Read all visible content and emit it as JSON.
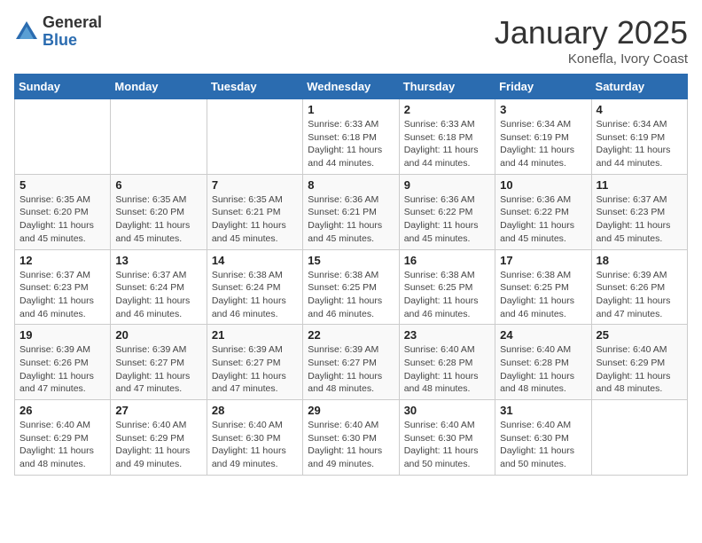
{
  "logo": {
    "general": "General",
    "blue": "Blue"
  },
  "title": "January 2025",
  "subtitle": "Konefla, Ivory Coast",
  "weekdays": [
    "Sunday",
    "Monday",
    "Tuesday",
    "Wednesday",
    "Thursday",
    "Friday",
    "Saturday"
  ],
  "weeks": [
    [
      {
        "day": "",
        "info": ""
      },
      {
        "day": "",
        "info": ""
      },
      {
        "day": "",
        "info": ""
      },
      {
        "day": "1",
        "info": "Sunrise: 6:33 AM\nSunset: 6:18 PM\nDaylight: 11 hours and 44 minutes."
      },
      {
        "day": "2",
        "info": "Sunrise: 6:33 AM\nSunset: 6:18 PM\nDaylight: 11 hours and 44 minutes."
      },
      {
        "day": "3",
        "info": "Sunrise: 6:34 AM\nSunset: 6:19 PM\nDaylight: 11 hours and 44 minutes."
      },
      {
        "day": "4",
        "info": "Sunrise: 6:34 AM\nSunset: 6:19 PM\nDaylight: 11 hours and 44 minutes."
      }
    ],
    [
      {
        "day": "5",
        "info": "Sunrise: 6:35 AM\nSunset: 6:20 PM\nDaylight: 11 hours and 45 minutes."
      },
      {
        "day": "6",
        "info": "Sunrise: 6:35 AM\nSunset: 6:20 PM\nDaylight: 11 hours and 45 minutes."
      },
      {
        "day": "7",
        "info": "Sunrise: 6:35 AM\nSunset: 6:21 PM\nDaylight: 11 hours and 45 minutes."
      },
      {
        "day": "8",
        "info": "Sunrise: 6:36 AM\nSunset: 6:21 PM\nDaylight: 11 hours and 45 minutes."
      },
      {
        "day": "9",
        "info": "Sunrise: 6:36 AM\nSunset: 6:22 PM\nDaylight: 11 hours and 45 minutes."
      },
      {
        "day": "10",
        "info": "Sunrise: 6:36 AM\nSunset: 6:22 PM\nDaylight: 11 hours and 45 minutes."
      },
      {
        "day": "11",
        "info": "Sunrise: 6:37 AM\nSunset: 6:23 PM\nDaylight: 11 hours and 45 minutes."
      }
    ],
    [
      {
        "day": "12",
        "info": "Sunrise: 6:37 AM\nSunset: 6:23 PM\nDaylight: 11 hours and 46 minutes."
      },
      {
        "day": "13",
        "info": "Sunrise: 6:37 AM\nSunset: 6:24 PM\nDaylight: 11 hours and 46 minutes."
      },
      {
        "day": "14",
        "info": "Sunrise: 6:38 AM\nSunset: 6:24 PM\nDaylight: 11 hours and 46 minutes."
      },
      {
        "day": "15",
        "info": "Sunrise: 6:38 AM\nSunset: 6:25 PM\nDaylight: 11 hours and 46 minutes."
      },
      {
        "day": "16",
        "info": "Sunrise: 6:38 AM\nSunset: 6:25 PM\nDaylight: 11 hours and 46 minutes."
      },
      {
        "day": "17",
        "info": "Sunrise: 6:38 AM\nSunset: 6:25 PM\nDaylight: 11 hours and 46 minutes."
      },
      {
        "day": "18",
        "info": "Sunrise: 6:39 AM\nSunset: 6:26 PM\nDaylight: 11 hours and 47 minutes."
      }
    ],
    [
      {
        "day": "19",
        "info": "Sunrise: 6:39 AM\nSunset: 6:26 PM\nDaylight: 11 hours and 47 minutes."
      },
      {
        "day": "20",
        "info": "Sunrise: 6:39 AM\nSunset: 6:27 PM\nDaylight: 11 hours and 47 minutes."
      },
      {
        "day": "21",
        "info": "Sunrise: 6:39 AM\nSunset: 6:27 PM\nDaylight: 11 hours and 47 minutes."
      },
      {
        "day": "22",
        "info": "Sunrise: 6:39 AM\nSunset: 6:27 PM\nDaylight: 11 hours and 48 minutes."
      },
      {
        "day": "23",
        "info": "Sunrise: 6:40 AM\nSunset: 6:28 PM\nDaylight: 11 hours and 48 minutes."
      },
      {
        "day": "24",
        "info": "Sunrise: 6:40 AM\nSunset: 6:28 PM\nDaylight: 11 hours and 48 minutes."
      },
      {
        "day": "25",
        "info": "Sunrise: 6:40 AM\nSunset: 6:29 PM\nDaylight: 11 hours and 48 minutes."
      }
    ],
    [
      {
        "day": "26",
        "info": "Sunrise: 6:40 AM\nSunset: 6:29 PM\nDaylight: 11 hours and 48 minutes."
      },
      {
        "day": "27",
        "info": "Sunrise: 6:40 AM\nSunset: 6:29 PM\nDaylight: 11 hours and 49 minutes."
      },
      {
        "day": "28",
        "info": "Sunrise: 6:40 AM\nSunset: 6:30 PM\nDaylight: 11 hours and 49 minutes."
      },
      {
        "day": "29",
        "info": "Sunrise: 6:40 AM\nSunset: 6:30 PM\nDaylight: 11 hours and 49 minutes."
      },
      {
        "day": "30",
        "info": "Sunrise: 6:40 AM\nSunset: 6:30 PM\nDaylight: 11 hours and 50 minutes."
      },
      {
        "day": "31",
        "info": "Sunrise: 6:40 AM\nSunset: 6:30 PM\nDaylight: 11 hours and 50 minutes."
      },
      {
        "day": "",
        "info": ""
      }
    ]
  ]
}
